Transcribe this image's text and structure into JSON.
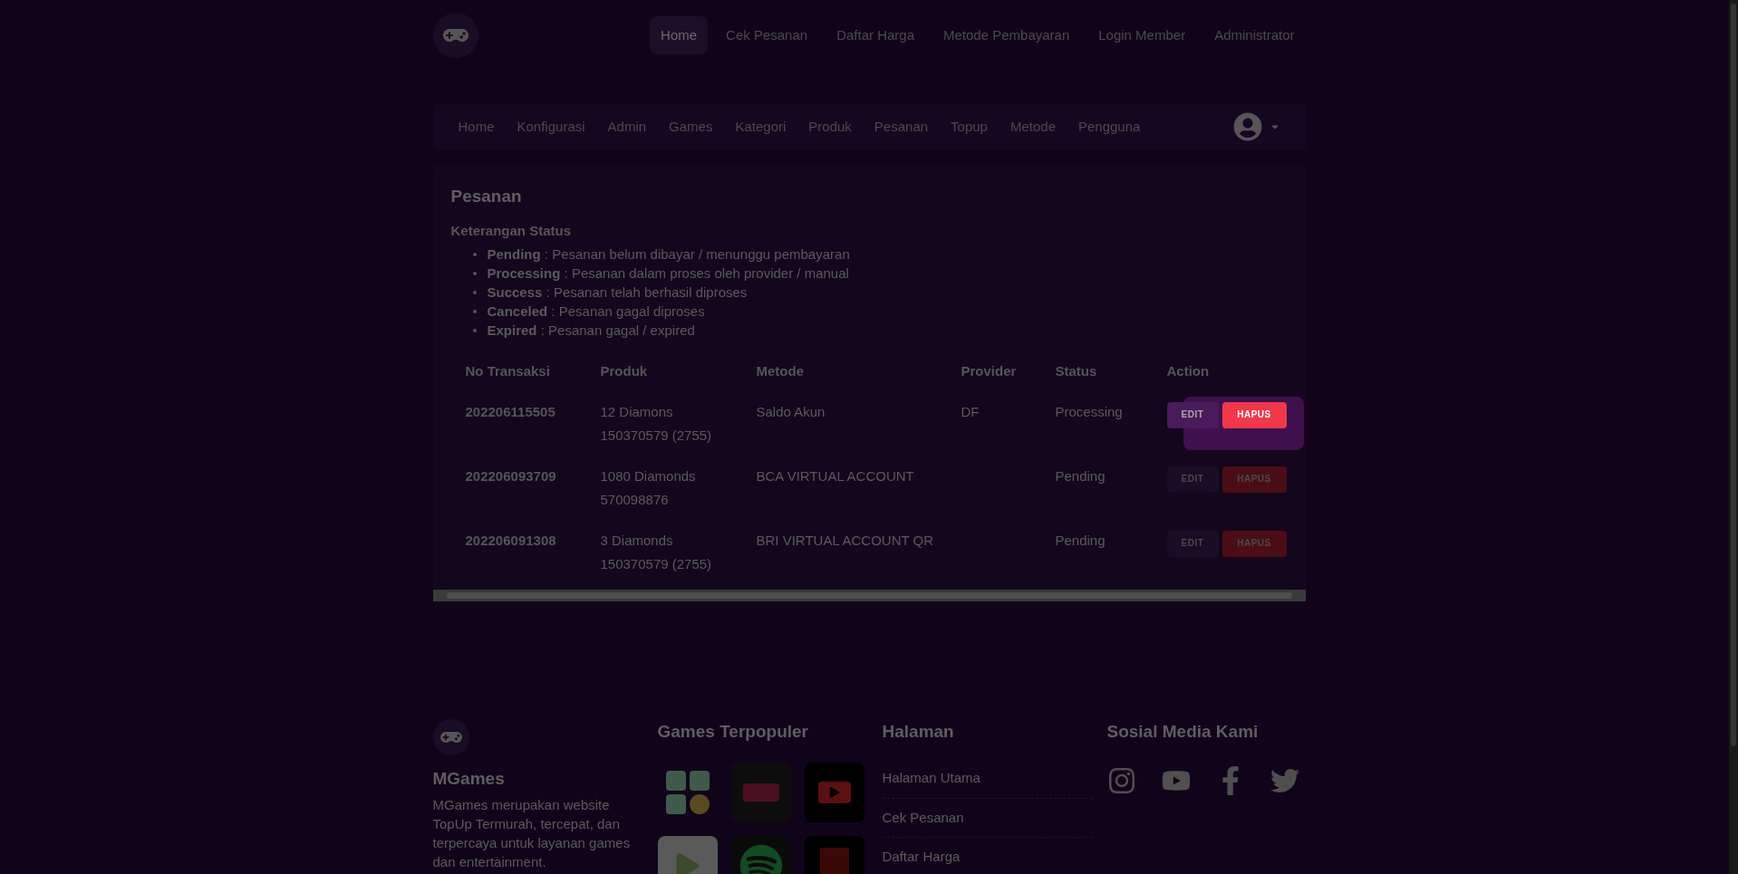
{
  "top_nav": {
    "items": [
      {
        "label": "Home",
        "selected": true
      },
      {
        "label": "Cek Pesanan",
        "selected": false
      },
      {
        "label": "Daftar Harga",
        "selected": false
      },
      {
        "label": "Metode Pembayaran",
        "selected": false
      },
      {
        "label": "Login Member",
        "selected": false
      },
      {
        "label": "Administrator",
        "selected": false
      }
    ]
  },
  "admin_nav": {
    "items": [
      {
        "label": "Home"
      },
      {
        "label": "Konfigurasi"
      },
      {
        "label": "Admin"
      },
      {
        "label": "Games"
      },
      {
        "label": "Kategori"
      },
      {
        "label": "Produk"
      },
      {
        "label": "Pesanan"
      },
      {
        "label": "Topup"
      },
      {
        "label": "Metode"
      },
      {
        "label": "Pengguna"
      }
    ]
  },
  "card": {
    "title": "Pesanan",
    "legend_title": "Keterangan Status",
    "legend": [
      {
        "status": "Pending",
        "text": " : Pesanan belum dibayar / menunggu pembayaran"
      },
      {
        "status": "Processing",
        "text": " : Pesanan dalam proses oleh provider / manual"
      },
      {
        "status": "Success",
        "text": " : Pesanan telah berhasil diproses"
      },
      {
        "status": "Canceled",
        "text": " : Pesanan gagal diproses"
      },
      {
        "status": "Expired",
        "text": " : Pesanan gagal / expired"
      }
    ]
  },
  "table": {
    "columns": [
      "No Transaksi",
      "Produk",
      "Metode",
      "Provider",
      "Status",
      "Action"
    ],
    "rows": [
      {
        "no": "202206115505",
        "produk": [
          "12 Diamons",
          "150370579 (2755)"
        ],
        "metode": "Saldo Akun",
        "provider": "DF",
        "status": "Processing",
        "edit": "EDIT",
        "hapus": "HAPUS",
        "highlighted": true
      },
      {
        "no": "202206093709",
        "produk": [
          "1080 Diamonds",
          "570098876"
        ],
        "metode": "BCA VIRTUAL ACCOUNT",
        "status": "Pending",
        "edit": "EDIT",
        "hapus": "HAPUS",
        "highlighted": false
      },
      {
        "no": "202206091308",
        "produk": [
          "3 Diamonds",
          "150370579 (2755)"
        ],
        "metode": "BRI VIRTUAL ACCOUNT QR",
        "status": "Pending",
        "edit": "EDIT",
        "hapus": "HAPUS",
        "highlighted": false
      }
    ]
  },
  "footer": {
    "brand": "MGames",
    "description": "MGames merupakan website TopUp Termurah, tercepat, dan terpercaya untuk layanan games dan entertainment.",
    "games_title": "Games Terpopuler",
    "games": [
      {
        "kind": "wallet"
      },
      {
        "kind": "vidio"
      },
      {
        "kind": "youtube"
      },
      {
        "kind": "play"
      },
      {
        "kind": "spotify"
      },
      {
        "kind": "netflix"
      }
    ],
    "pages_title": "Halaman",
    "pages": [
      "Halaman Utama",
      "Cek Pesanan",
      "Daftar Harga"
    ],
    "social_title": "Sosial Media Kami",
    "social": [
      {
        "kind": "instagram"
      },
      {
        "kind": "youtube"
      },
      {
        "kind": "facebook"
      },
      {
        "kind": "twitter"
      }
    ]
  }
}
